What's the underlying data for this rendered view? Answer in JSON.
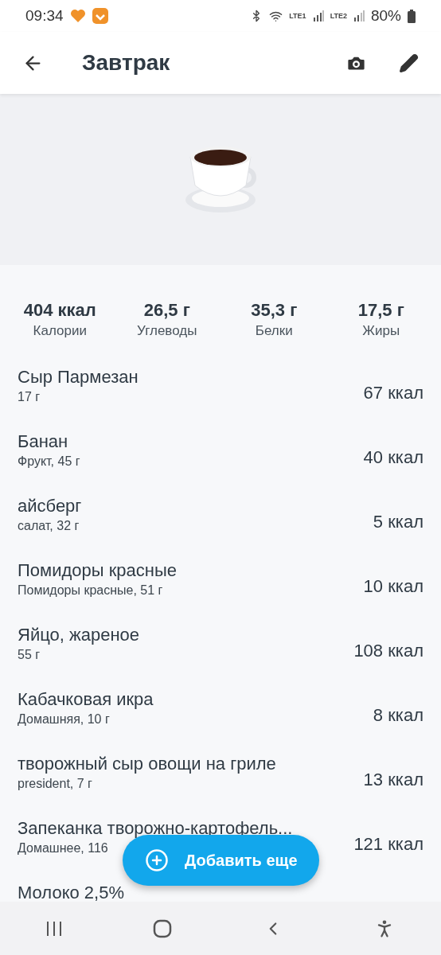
{
  "status_bar": {
    "time": "09:34",
    "sim_1": "LTE1",
    "sim_2": "LTE2",
    "battery": "80%"
  },
  "header": {
    "title": "Завтрак"
  },
  "summary": [
    {
      "value": "404 ккал",
      "label": "Калории"
    },
    {
      "value": "26,5 г",
      "label": "Углеводы"
    },
    {
      "value": "35,3 г",
      "label": "Белки"
    },
    {
      "value": "17,5 г",
      "label": "Жиры"
    }
  ],
  "foods": [
    {
      "name": "Сыр Пармезан",
      "detail": "17 г",
      "calories": "67 ккал"
    },
    {
      "name": "Банан",
      "detail": "Фрукт, 45 г",
      "calories": "40 ккал"
    },
    {
      "name": "айсберг",
      "detail": "салат, 32 г",
      "calories": "5 ккал"
    },
    {
      "name": "Помидоры красные",
      "detail": "Помидоры красные, 51 г",
      "calories": "10 ккал"
    },
    {
      "name": "Яйцо, жареное",
      "detail": "55 г",
      "calories": "108 ккал"
    },
    {
      "name": "Кабачковая икра",
      "detail": "Домашняя, 10 г",
      "calories": "8 ккал"
    },
    {
      "name": "творожный сыр овощи на гриле",
      "detail": "president, 7 г",
      "calories": "13 ккал"
    },
    {
      "name": "Запеканка творожно-картофель...",
      "detail": "Домашнее, 116",
      "calories": "121 ккал"
    },
    {
      "name": "Молоко 2,5%"
    }
  ],
  "add_button": {
    "label": "Добавить еще"
  }
}
